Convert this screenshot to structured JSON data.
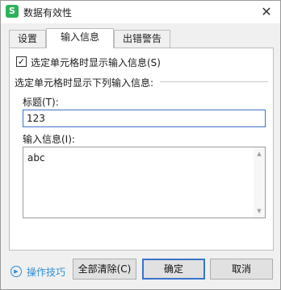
{
  "window": {
    "title": "数据有效性",
    "app_icon_letter": "S",
    "app_icon_color": "#2fb15b",
    "close_glyph": "✕"
  },
  "tabs": [
    {
      "label": "设置",
      "active": false
    },
    {
      "label": "输入信息",
      "active": true
    },
    {
      "label": "出错警告",
      "active": false
    }
  ],
  "input_message": {
    "show_checkbox": {
      "label": "选定单元格时显示输入信息(S)",
      "checked": true,
      "check_glyph": "✓"
    },
    "group_label": "选定单元格时显示下列输入信息:",
    "title_label": "标题(T):",
    "title_value": "123",
    "message_label": "输入信息(I):",
    "message_value": "abc"
  },
  "footer": {
    "tips_label": "操作技巧",
    "tips_icon": "▶",
    "clear_all_label": "全部清除(C)",
    "ok_label": "确定",
    "cancel_label": "取消"
  },
  "colors": {
    "accent": "#3a74c9",
    "link": "#2f8fd8",
    "dialog_bg": "#f0f0f0"
  }
}
